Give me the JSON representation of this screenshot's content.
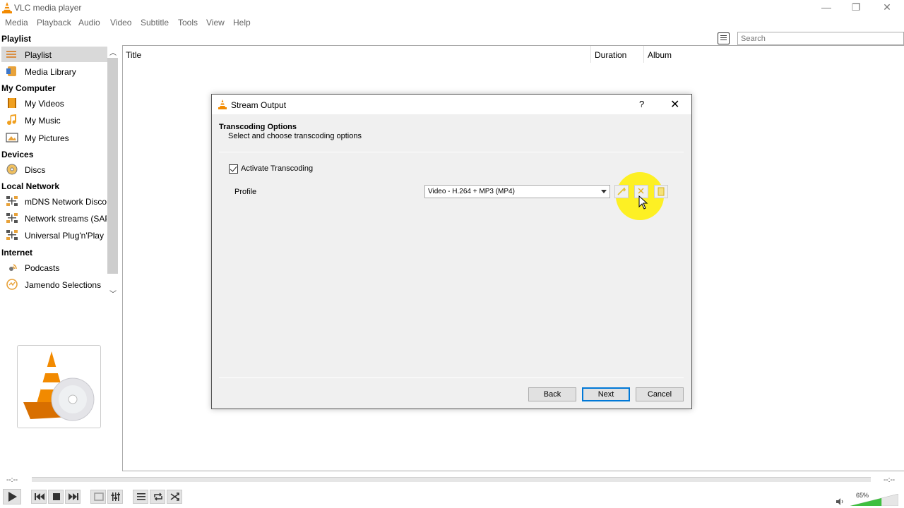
{
  "window": {
    "title": "VLC media player",
    "controls": [
      "minimize",
      "restore",
      "close"
    ]
  },
  "menu": [
    "Media",
    "Playback",
    "Audio",
    "Video",
    "Subtitle",
    "Tools",
    "View",
    "Help"
  ],
  "playlist_header": "Playlist",
  "search": {
    "placeholder": "Search"
  },
  "sidebar": {
    "items": [
      {
        "label": "Playlist",
        "icon": "playlist-icon",
        "selected": true
      },
      {
        "label": "Media Library",
        "icon": "media-library-icon"
      }
    ],
    "categories": [
      {
        "label": "My Computer",
        "items": [
          {
            "label": "My Videos",
            "icon": "videos-icon"
          },
          {
            "label": "My Music",
            "icon": "music-icon"
          },
          {
            "label": "My Pictures",
            "icon": "pictures-icon"
          }
        ]
      },
      {
        "label": "Devices",
        "items": [
          {
            "label": "Discs",
            "icon": "disc-icon"
          }
        ]
      },
      {
        "label": "Local Network",
        "items": [
          {
            "label": "mDNS Network Disco...",
            "icon": "network-icon"
          },
          {
            "label": "Network streams (SAP)",
            "icon": "network-icon"
          },
          {
            "label": "Universal Plug'n'Play",
            "icon": "network-icon"
          }
        ]
      },
      {
        "label": "Internet",
        "items": [
          {
            "label": "Podcasts",
            "icon": "podcast-icon"
          },
          {
            "label": "Jamendo Selections",
            "icon": "jamendo-icon"
          }
        ]
      }
    ]
  },
  "table": {
    "columns": [
      "Title",
      "Duration",
      "Album"
    ]
  },
  "dialog": {
    "title": "Stream Output",
    "help": "?",
    "close": "✕",
    "heading": "Transcoding Options",
    "subheading": "Select and choose transcoding options",
    "activate_label": "Activate Transcoding",
    "activate_checked": true,
    "profile_label": "Profile",
    "profile_value": "Video - H.264 + MP3 (MP4)",
    "buttons": {
      "back": "Back",
      "next": "Next",
      "cancel": "Cancel"
    }
  },
  "player": {
    "elapsed": "--:--",
    "remaining": "--:--",
    "volume": "65%",
    "volume_level": 0.65
  },
  "colors": {
    "accent": "#0078d7",
    "vlc_orange": "#f28a00",
    "highlight": "#fff000",
    "volume_green": "#3fbf3f"
  }
}
